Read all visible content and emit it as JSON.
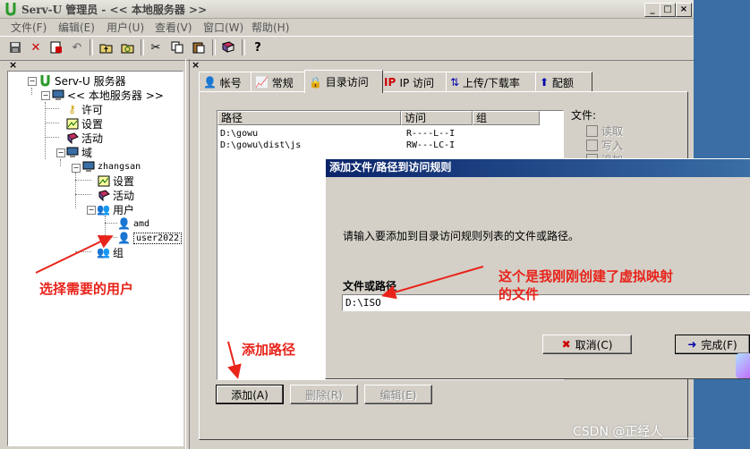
{
  "window": {
    "title": "Serv-U 管理员 - << 本地服务器 >>",
    "min": "_",
    "max": "□",
    "close": "×"
  },
  "menu": [
    "文件(F)",
    "编辑(E)",
    "用户(U)",
    "查看(V)",
    "窗口(W)",
    "帮助(H)"
  ],
  "toolbar": {
    "pane_close": "×"
  },
  "tree": {
    "root": "Serv-U 服务器",
    "server": "<< 本地服务器 >>",
    "license": "许可",
    "settings": "设置",
    "activity": "活动",
    "domains": "域",
    "domain": "zhangsan",
    "domain_settings": "设置",
    "domain_activity": "活动",
    "users": "用户",
    "user1": "amd",
    "user2": "user2022",
    "groups": "组"
  },
  "tabs": [
    "帐号",
    "常规",
    "目录访问",
    "IP 访问",
    "上传/下载率",
    "配额"
  ],
  "dir_list": {
    "columns": [
      "路径",
      "访问",
      "组"
    ],
    "rows": [
      {
        "path": "D:\\gowu",
        "access": "R----L--I",
        "group": ""
      },
      {
        "path": "D:\\gowu\\dist\\js",
        "access": "RW---LC-I",
        "group": ""
      }
    ]
  },
  "file_perm": {
    "label": "文件:",
    "read": "读取",
    "write": "写入",
    "append": "追加"
  },
  "buttons": {
    "add": "添加(A)",
    "remove": "删除(R)",
    "edit": "编辑(E)"
  },
  "dialog": {
    "title": "添加文件/路径到访问规则",
    "prompt": "请输入要添加到目录访问规则列表的文件或路径。",
    "field_label": "文件或路径",
    "field_value": "D:\\ISO",
    "cancel": "取消(C)",
    "finish": "完成(F)"
  },
  "annotations": {
    "select_user": "选择需要的用户",
    "add_path": "添加路径",
    "note_line1": "这个是我刚刚创建了虚拟映射",
    "note_line2": "的文件"
  },
  "watermark": "CSDN @正经人_____",
  "colors": {
    "dialog_title": "#0a246a",
    "annotation": "#e8231a",
    "desktop": "#3a6ea5"
  }
}
